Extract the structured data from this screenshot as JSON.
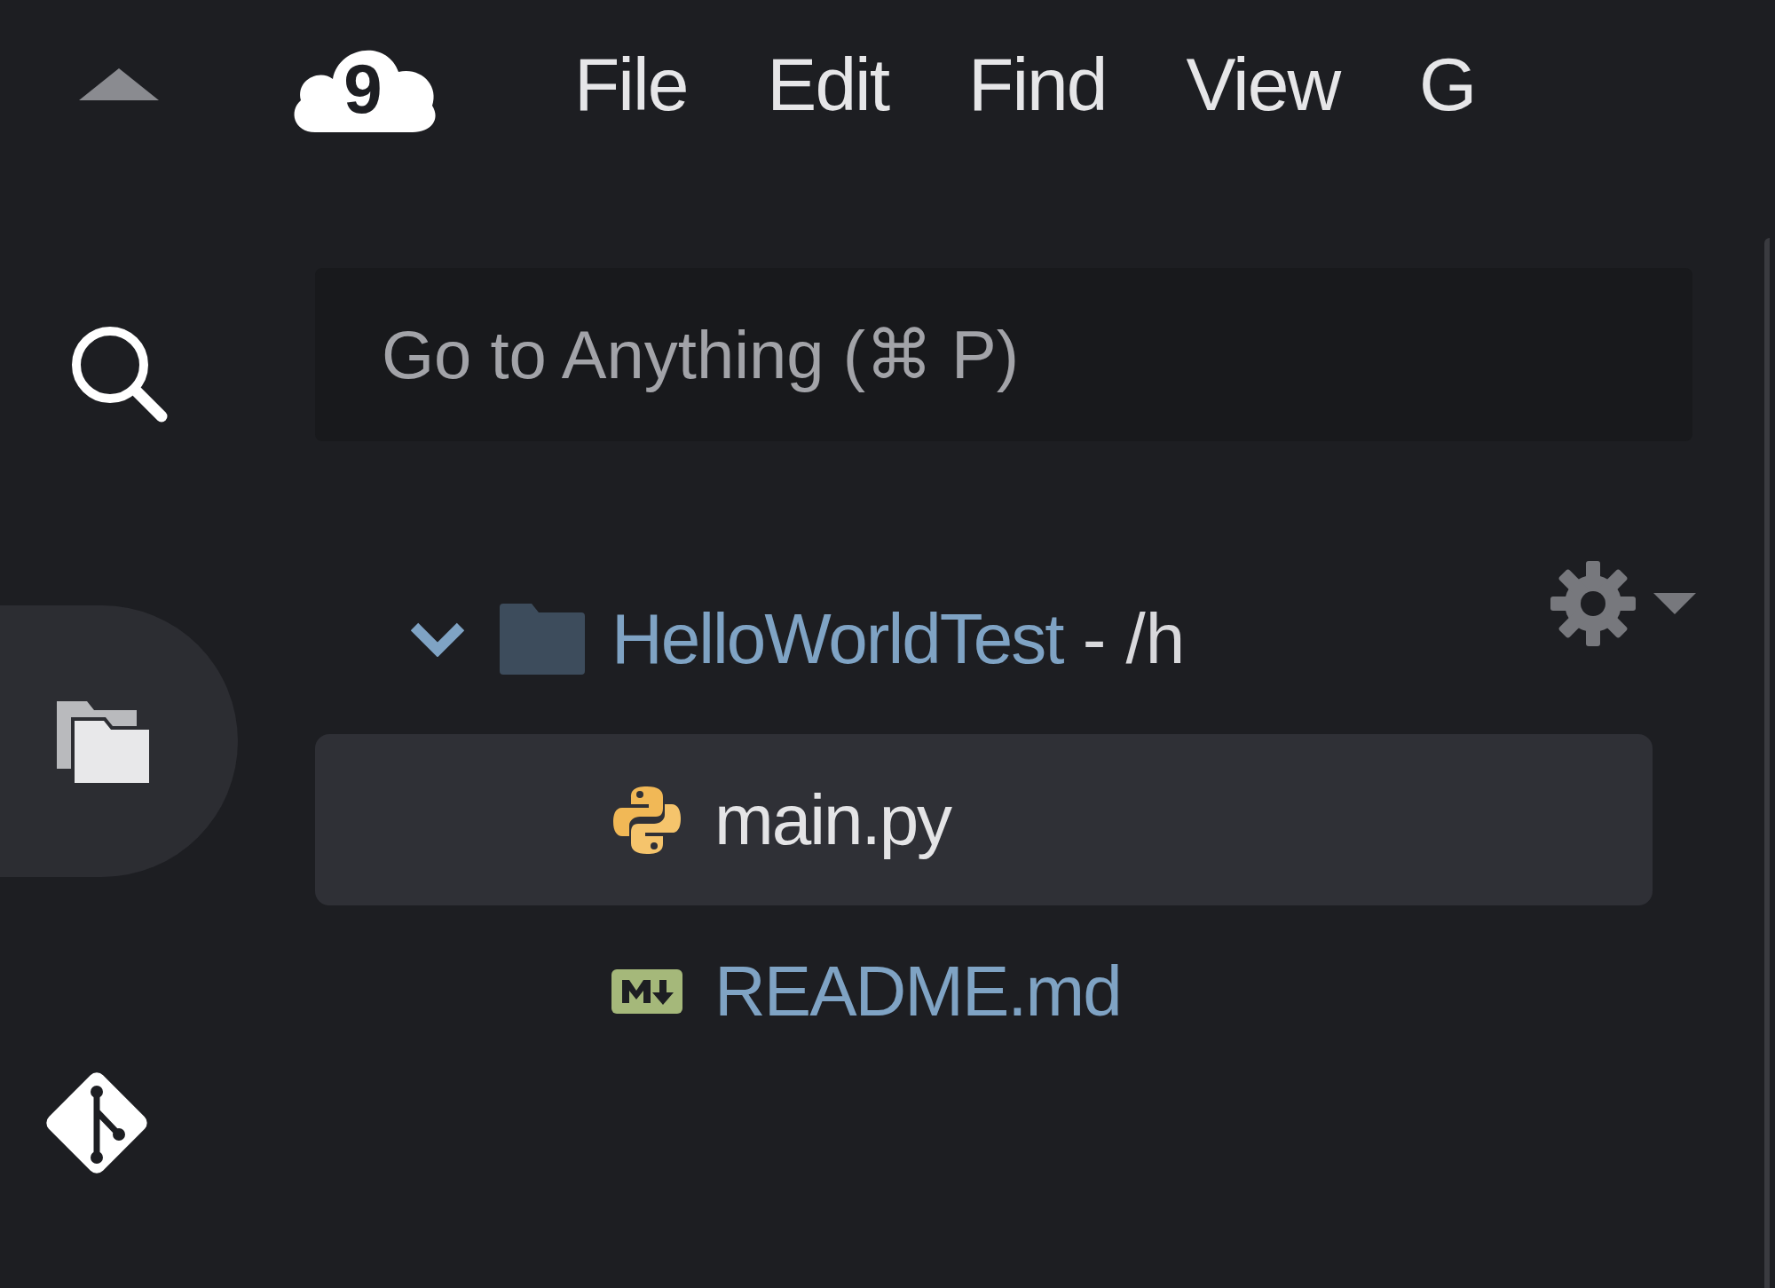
{
  "logo": {
    "text": "9"
  },
  "menu": [
    {
      "label": "File"
    },
    {
      "label": "Edit"
    },
    {
      "label": "Find"
    },
    {
      "label": "View"
    },
    {
      "label": "G"
    }
  ],
  "rail": [
    {
      "kind": "search",
      "selected": false
    },
    {
      "kind": "files",
      "selected": true
    },
    {
      "kind": "git",
      "selected": false
    }
  ],
  "search": {
    "placeholder": "Go to Anything (⌘ P)"
  },
  "tree": {
    "label": "HelloWorldTest",
    "path": " - /h",
    "expanded": true,
    "children": [
      {
        "name": "main.py",
        "kind": "python",
        "selected": true
      },
      {
        "name": "README.md",
        "kind": "markdown",
        "selected": false
      }
    ]
  }
}
